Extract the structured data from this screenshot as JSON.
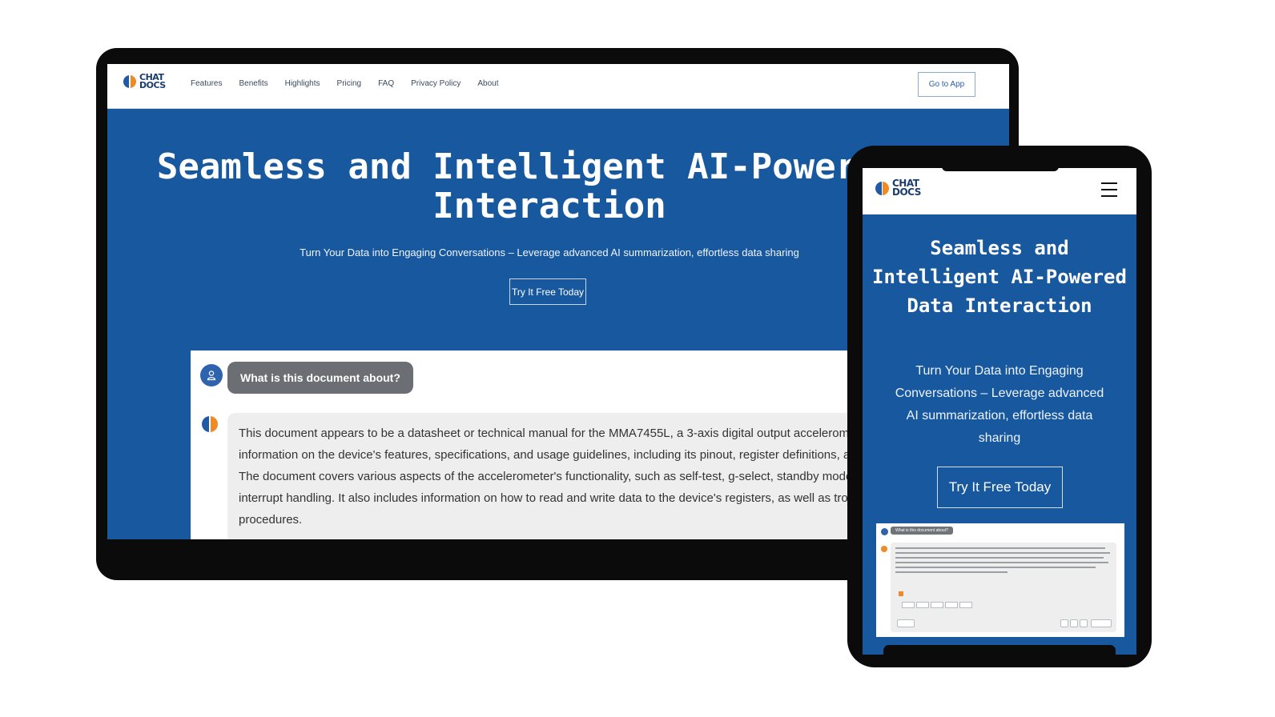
{
  "desktop": {
    "logo_top": "CHAT",
    "logo_bottom": "DOCS",
    "nav": [
      "Features",
      "Benefits",
      "Highlights",
      "Pricing",
      "FAQ",
      "Privacy Policy",
      "About"
    ],
    "cta": "Go to App",
    "hero_title_line1": "Seamless and Intelligent AI-Powered D",
    "hero_title_line2": "Interaction",
    "hero_subtitle": "Turn Your Data into Engaging Conversations – Leverage advanced AI summarization, effortless data sharing",
    "try_button": "Try It Free Today",
    "chat": {
      "question": "What is this document about?",
      "answer": "This document appears to be a datasheet or technical manual for the MMA7455L, a 3-axis digital output accelerometer. It provides detailed information on the device's features, specifications, and usage guidelines, including its pinout, register definitions, and communication protocols. The document covers various aspects of the accelerometer's functionality, such as self-test, g-select, standby mode, measurement mode, and interrupt handling. It also includes information on how to read and write data to the device's registers, as well as troubleshooting and error handling procedures."
    }
  },
  "phone": {
    "logo_top": "CHAT",
    "logo_bottom": "DOCS",
    "menu_icon": "hamburger-menu-icon",
    "hero_title": "Seamless and Intelligent AI-Powered Data Interaction",
    "hero_subtitle": "Turn Your Data into Engaging Conversations – Leverage advanced AI summarization, effortless data sharing",
    "try_button": "Try It Free Today"
  },
  "colors": {
    "brand_blue": "#17589f",
    "logo_orange": "#f08a24",
    "bubble_gray": "#6b6e72"
  }
}
